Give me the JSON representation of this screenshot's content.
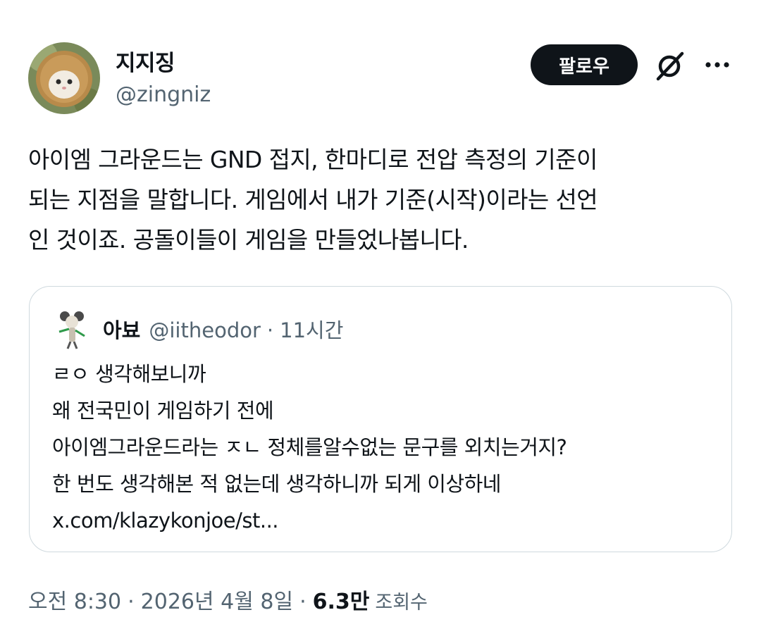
{
  "author": {
    "display_name": "지지징",
    "handle": "@zingniz"
  },
  "actions": {
    "follow_label": "팔로우",
    "grok_icon": "grok-icon",
    "more_icon": "more-icon"
  },
  "tweet": {
    "lines": [
      "아이엠 그라운드는 GND 접지, 한마디로 전압 측정의 기준이",
      "되는 지점을 말합니다. 게임에서 내가 기준(시작)이라는 선언",
      "인 것이죠. 공돌이들이 게임을 만들었나봅니다."
    ]
  },
  "quote": {
    "display_name": "아뵤",
    "handle": "@iitheodor",
    "separator": "·",
    "time": "11시간",
    "lines": [
      "ㄹㅇ 생각해보니까",
      "왜 전국민이 게임하기 전에",
      "아이엠그라운드라는 ㅈㄴ 정체를알수없는 문구를 외치는거지?",
      "한 번도 생각해본 적 없는데 생각하니까 되게 이상하네",
      "x.com/klazykonjoe/st..."
    ]
  },
  "meta": {
    "time": "오전 8:30",
    "date": "2026년 4월 8일",
    "separator": "·",
    "views_count": "6.3만",
    "views_label": "조회수"
  }
}
